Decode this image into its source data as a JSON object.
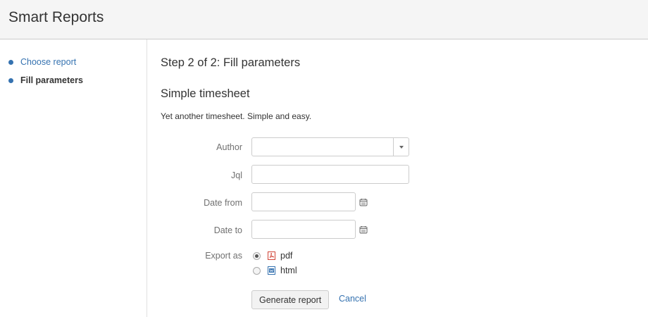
{
  "app": {
    "title": "Smart Reports"
  },
  "sidebar": {
    "items": [
      {
        "label": "Choose report",
        "state": "link"
      },
      {
        "label": "Fill parameters",
        "state": "current"
      }
    ]
  },
  "main": {
    "step_title": "Step 2 of 2: Fill parameters",
    "report_title": "Simple timesheet",
    "report_description": "Yet another timesheet. Simple and easy."
  },
  "form": {
    "author": {
      "label": "Author",
      "value": "",
      "icon": "chevron-down-icon"
    },
    "jql": {
      "label": "Jql",
      "value": ""
    },
    "date_from": {
      "label": "Date from",
      "value": "",
      "icon": "calendar-icon"
    },
    "date_to": {
      "label": "Date to",
      "value": "",
      "icon": "calendar-icon"
    },
    "export": {
      "label": "Export as",
      "options": [
        {
          "label": "pdf",
          "selected": true,
          "icon": "pdf-file-icon"
        },
        {
          "label": "html",
          "selected": false,
          "icon": "html-file-icon"
        }
      ]
    }
  },
  "actions": {
    "generate_label": "Generate report",
    "cancel_label": "Cancel"
  },
  "colors": {
    "link": "#3572b0",
    "pdf_icon": "#d04437",
    "html_icon": "#3572b0",
    "header_bg": "#f5f5f5"
  }
}
